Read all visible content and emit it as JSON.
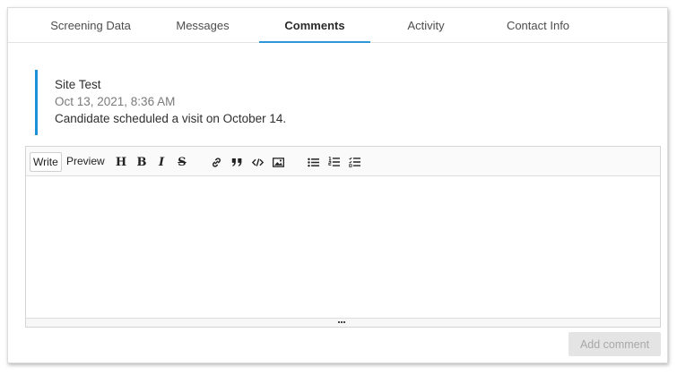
{
  "tabs": [
    {
      "label": "Screening Data",
      "active": false
    },
    {
      "label": "Messages",
      "active": false
    },
    {
      "label": "Comments",
      "active": true
    },
    {
      "label": "Activity",
      "active": false
    },
    {
      "label": "Contact Info",
      "active": false
    }
  ],
  "comment": {
    "author": "Site Test",
    "date": "Oct 13, 2021, 8:36 AM",
    "text": "Candidate scheduled a visit on October 14."
  },
  "editor": {
    "write_label": "Write",
    "preview_label": "Preview",
    "mode": "Write",
    "value": "",
    "icons": [
      "heading-icon",
      "bold-icon",
      "italic-icon",
      "strikethrough-icon",
      "link-icon",
      "quote-icon",
      "code-icon",
      "image-icon",
      "bullet-list-icon",
      "numbered-list-icon",
      "task-list-icon"
    ],
    "heading_glyph": "H",
    "bold_glyph": "B",
    "italic_glyph": "I",
    "strike_glyph": "S"
  },
  "actions": {
    "add_comment_label": "Add comment",
    "add_comment_enabled": false
  },
  "colors": {
    "accent": "#1b91d8",
    "disabled_bg": "#e4e4e4",
    "disabled_text": "#a8a8a8"
  }
}
